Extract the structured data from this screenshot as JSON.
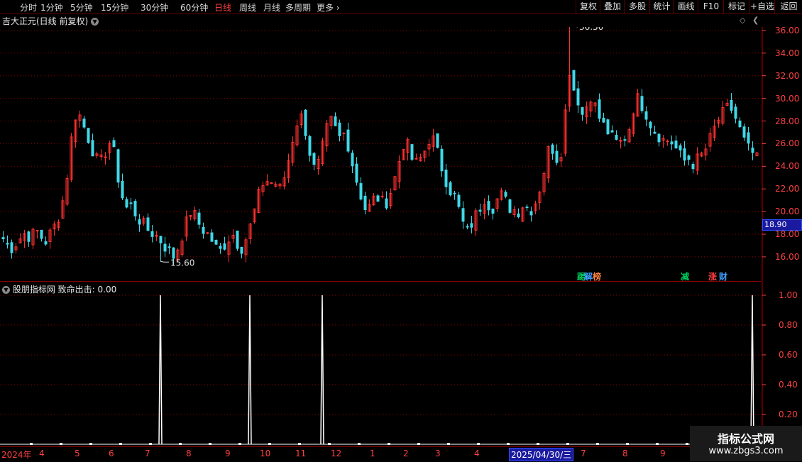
{
  "toolbar": {
    "timeframes": [
      "分时",
      "1分钟",
      "5分钟",
      "15分钟",
      "30分钟",
      "60分钟",
      "日线",
      "周线",
      "月线",
      "多周期",
      "更多"
    ],
    "active_timeframe": "日线",
    "right_buttons": [
      "复权",
      "叠加",
      "多股",
      "统计",
      "画线",
      "F10",
      "标记",
      "+自选",
      "返回"
    ]
  },
  "main": {
    "title": "吉大正元(日线 前复权)",
    "current_price": "18.90",
    "y_tick_labels": [
      "36.00",
      "34.00",
      "32.00",
      "30.00",
      "28.00",
      "26.00",
      "24.00",
      "22.00",
      "20.00",
      "18.00",
      "16.00"
    ],
    "high_annotation": "36.50",
    "low_annotation": "15.60",
    "tags": [
      {
        "text": "踢",
        "color": "#00d060"
      },
      {
        "text": "解",
        "color": "#40a0ff"
      },
      {
        "text": "榜",
        "color": "#ff8040"
      },
      {
        "text": "减",
        "color": "#00d060"
      },
      {
        "text": "涨",
        "color": "#ff4040"
      },
      {
        "text": "财",
        "color": "#40a0ff"
      }
    ]
  },
  "indicator": {
    "title": "股朋指标网  致命出击: 0.00",
    "y_tick_labels": [
      "1.00",
      "0.80",
      "0.60",
      "0.40",
      "0.20"
    ]
  },
  "date_axis": {
    "labels": [
      "2024年",
      "4",
      "5",
      "6",
      "7",
      "8",
      "9",
      "10",
      "11",
      "12",
      "1",
      "2",
      "3",
      "4",
      "7",
      "8",
      "9"
    ],
    "highlight": "2025/04/30/三"
  },
  "watermark": {
    "line1": "指标公式网",
    "line2": "www.zbgs3.com"
  },
  "colors": {
    "up": "#ff3030",
    "down": "#40d8e8",
    "axis": "#ff4040",
    "grid": "#8a0000",
    "signal": "#ffffff"
  },
  "chart_data": {
    "type": "candlestick",
    "title": "吉大正元(日线 前复权)",
    "ylim": [
      15,
      37
    ],
    "close_path": [
      17.6,
      17.0,
      16.8,
      17.3,
      17.8,
      18.2,
      17.6,
      18.4,
      18.0,
      17.2,
      17.9,
      18.6,
      19.5,
      21.0,
      23.5,
      27.0,
      29.0,
      28.2,
      27.0,
      26.0,
      24.8,
      24.2,
      25.0,
      26.2,
      25.4,
      23.0,
      21.2,
      20.2,
      20.6,
      19.6,
      19.1,
      18.6,
      18.2,
      18.0,
      17.6,
      17.0,
      16.6,
      16.0,
      16.8,
      18.0,
      19.2,
      20.2,
      19.4,
      18.6,
      18.2,
      17.8,
      17.0,
      16.4,
      17.0,
      17.6,
      18.0,
      17.2,
      16.8,
      17.8,
      19.0,
      20.6,
      22.0,
      23.0,
      22.4,
      22.8,
      21.8,
      22.8,
      24.4,
      26.4,
      28.0,
      28.4,
      26.8,
      24.6,
      23.4,
      24.8,
      26.6,
      28.2,
      27.6,
      26.4,
      27.0,
      26.0,
      24.2,
      22.6,
      21.2,
      20.0,
      20.6,
      21.4,
      21.0,
      20.6,
      21.4,
      22.6,
      24.2,
      26.0,
      25.8,
      24.6,
      24.2,
      24.8,
      25.6,
      26.8,
      26.0,
      24.4,
      23.2,
      22.0,
      21.6,
      20.4,
      19.0,
      18.2,
      19.0,
      19.8,
      20.6,
      21.4,
      20.2,
      20.6,
      21.6,
      21.2,
      20.4,
      20.2,
      20.0,
      20.6,
      20.4,
      20.2,
      21.0,
      22.4,
      24.2,
      26.2,
      25.0,
      24.4,
      27.0,
      33.0,
      31.0,
      30.0,
      28.6,
      29.4,
      30.4,
      29.0,
      28.0,
      27.4,
      26.8,
      26.2,
      26.0,
      26.4,
      27.0,
      29.0,
      30.0,
      29.4,
      28.6,
      27.6,
      27.0,
      26.6,
      26.2,
      26.4,
      25.8,
      25.2,
      24.4,
      24.8,
      24.2,
      24.6,
      25.0,
      25.6,
      26.6,
      27.6,
      28.4,
      28.8,
      29.4,
      28.6,
      27.6,
      26.4,
      25.6,
      25.2,
      24.6
    ],
    "high": 36.5,
    "low": 15.6,
    "indicator": {
      "name": "致命出击",
      "value": 0.0,
      "ylim": [
        0,
        1.1
      ],
      "spike_indices": [
        37,
        58,
        75,
        176
      ]
    }
  }
}
